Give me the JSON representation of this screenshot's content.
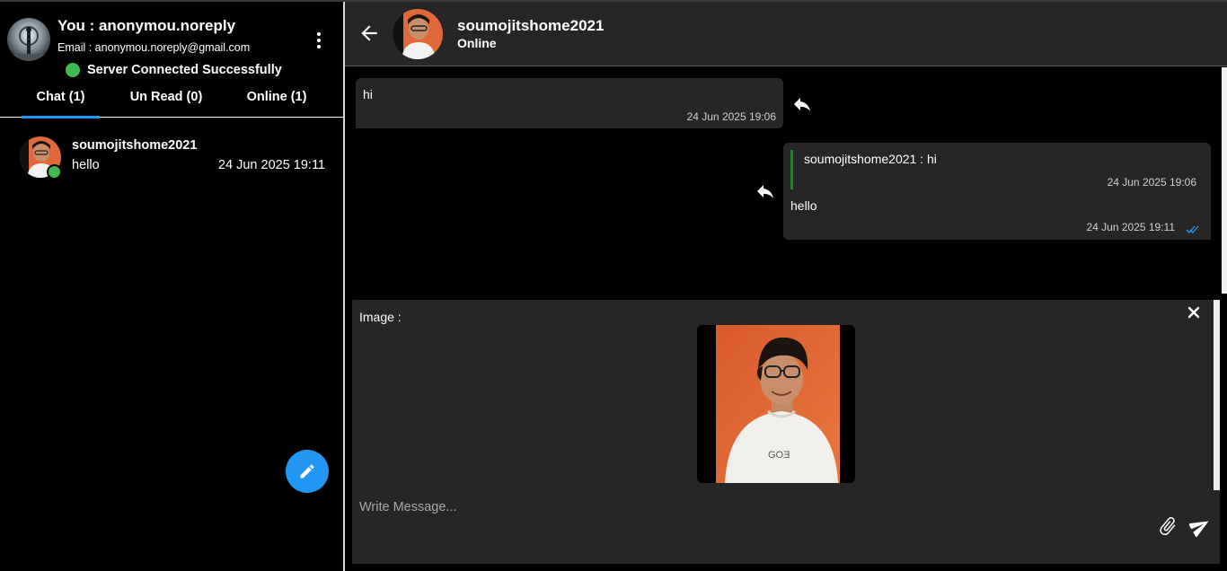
{
  "user": {
    "title": "You : anonymou.noreply",
    "email": "Email : anonymou.noreply@gmail.com",
    "server_status": "Server Connected Successfully"
  },
  "tabs": [
    {
      "label": "Chat (1)",
      "active": true
    },
    {
      "label": "Un Read (0)",
      "active": false
    },
    {
      "label": "Online (1)",
      "active": false
    }
  ],
  "conversations": [
    {
      "name": "soumojitshome2021",
      "last_message": "hello",
      "time": "24 Jun 2025 19:11",
      "online": true
    }
  ],
  "chat": {
    "peer_name": "soumojitshome2021",
    "peer_status": "Online",
    "messages": [
      {
        "direction": "incoming",
        "text": "hi",
        "time": "24 Jun 2025 19:06"
      },
      {
        "direction": "outgoing",
        "reply_to_text": "soumojitshome2021 : hi",
        "reply_to_time": "24 Jun 2025 19:06",
        "text": "hello",
        "time": "24 Jun 2025 19:11",
        "read": true
      }
    ]
  },
  "composer": {
    "attachment_label": "Image :",
    "placeholder": "Write Message..."
  },
  "colors": {
    "accent": "#2196f3",
    "online": "#3fb950",
    "surface": "#262626",
    "background": "#000000",
    "quote_bar": "#2e7d32"
  },
  "icons": {
    "menu": "more-vertical-icon",
    "compose": "pencil-icon",
    "back": "arrow-left-icon",
    "reply": "reply-icon",
    "close": "close-icon",
    "attach": "paperclip-icon",
    "send": "send-icon",
    "read": "double-check-icon"
  }
}
